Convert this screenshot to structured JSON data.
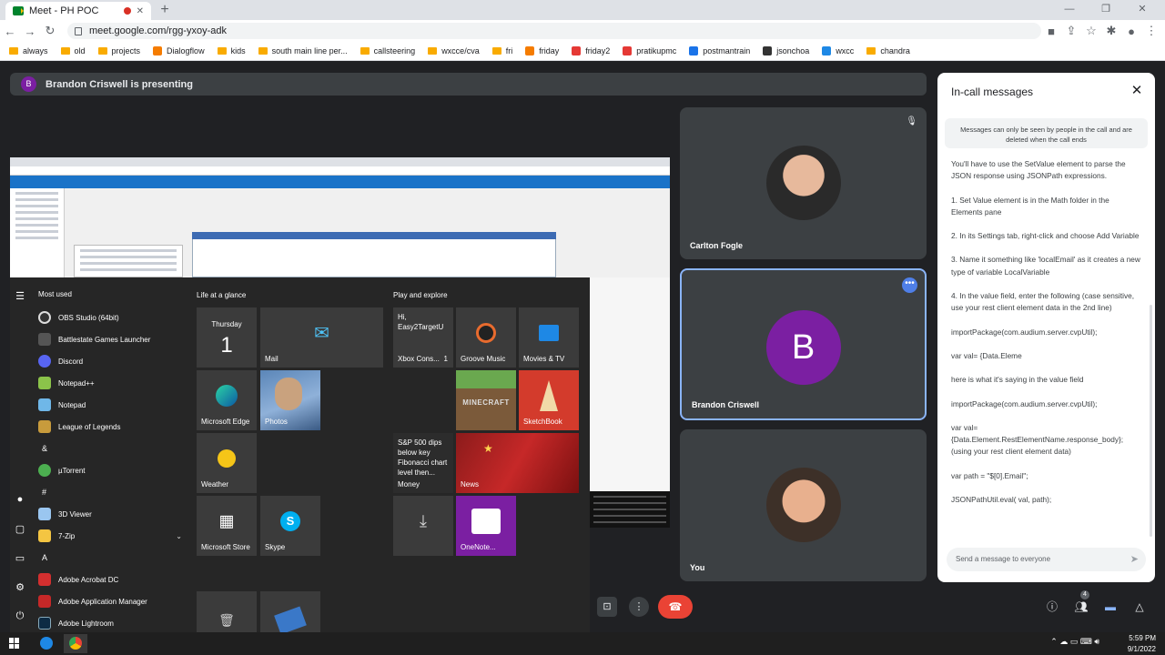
{
  "browser": {
    "tab_title": "Meet - PH POC",
    "new_tab_label": "+",
    "url": "meet.google.com/rgg-yxoy-adk",
    "bookmarks": [
      "always",
      "old",
      "projects",
      "Dialogflow",
      "kids",
      "south main line per...",
      "callsteering",
      "wxcce/cva",
      "fri",
      "friday",
      "friday2",
      "pratikupmc",
      "postmantrain",
      "jsonchoa",
      "wxcc",
      "chandra"
    ]
  },
  "meet": {
    "presenter_initial": "B",
    "presenter_text": "Brandon Criswell is presenting",
    "participants": [
      {
        "name": "Carlton Fogle"
      },
      {
        "name": "Brandon Criswell",
        "initial": "B"
      },
      {
        "name": "You"
      }
    ],
    "participant_count": "4"
  },
  "start_menu": {
    "most_used_header": "Most used",
    "most_used": [
      "OBS Studio (64bit)",
      "Battlestate Games Launcher",
      "Discord",
      "Notepad++",
      "Notepad",
      "League of Legends"
    ],
    "sections": [
      {
        "letter": "&",
        "apps": [
          "µTorrent"
        ]
      },
      {
        "letter": "#",
        "apps": [
          "3D Viewer",
          "7-Zip"
        ]
      },
      {
        "letter": "A",
        "apps": [
          "Adobe Acrobat DC",
          "Adobe Application Manager",
          "Adobe Lightroom"
        ]
      }
    ],
    "life_header": "Life at a glance",
    "play_header": "Play and explore",
    "calendar_day": "Thursday",
    "calendar_date": "1",
    "tiles": {
      "mail": "Mail",
      "edge": "Microsoft Edge",
      "photos": "Photos",
      "weather": "Weather",
      "store": "Microsoft Store",
      "skype": "Skype",
      "xbox": "Xbox Cons...",
      "xbox_msg": "Hi, Easy2TargetU",
      "xbox_count": "1",
      "groove": "Groove Music",
      "movies": "Movies & TV",
      "minecraft": "MINECRAFT",
      "sketchbook": "SketchBook",
      "money": "Money",
      "money_headline": "S&P 500 dips below key Fibonacci chart level then...",
      "news": "News",
      "onenote": "OneNote..."
    }
  },
  "chat": {
    "title": "In-call messages",
    "notice": "Messages can only be seen by people in the call and are deleted when the call ends",
    "messages": [
      "You'll have to use the SetValue element to parse the JSON response using JSONPath expressions.",
      "1. Set Value element is in the Math folder in the Elements pane",
      "2. In its Settings tab, right-click and choose Add Variable",
      "3. Name it something like 'localEmail' as it creates a new type of variable LocalVariable",
      "4. In the value field, enter the following (case sensitive, use your rest client element data in the 2nd line)",
      "importPackage(com.audium.server.cvpUtil);",
      "var  val= {Data.Eleme",
      "here is what it's saying in the value field",
      "importPackage(com.audium.server.cvpUtil);",
      "var  val= {Data.Element.RestElementName.response_body}; (using your rest client element data)",
      "var path = \"$[0].Email\";",
      "JSONPathUtil.eval( val, path);"
    ],
    "input_placeholder": "Send a message to everyone"
  },
  "taskbar": {
    "time": "5:59 PM",
    "date": "9/1/2022"
  }
}
